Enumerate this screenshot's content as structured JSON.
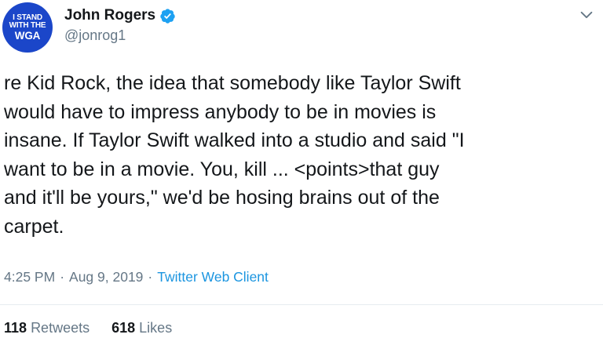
{
  "colors": {
    "avatar_bg": "#1b46c9",
    "verified_badge": "#1da1f2",
    "link": "#1b95e0",
    "secondary_text": "#657786",
    "primary_text": "#14171a"
  },
  "author": {
    "avatar_lines": [
      "I STAND",
      "WITH THE",
      "WGA"
    ],
    "display_name": "John Rogers",
    "handle": "@jonrog1",
    "verified_icon": "verified-badge-icon"
  },
  "menu": {
    "icon": "chevron-down-icon"
  },
  "tweet": {
    "lines": [
      "re Kid Rock, the idea that somebody like Taylor Swift",
      "would have to impress anybody to be in movies is",
      "insane. If Taylor Swift walked into a studio and said \"I",
      "want to be in a movie. You, kill ... <points>that guy",
      "and it'll be yours,\" we'd be hosing brains out of the",
      "carpet."
    ]
  },
  "meta": {
    "time": "4:25 PM",
    "separator": "·",
    "date": "Aug 9, 2019",
    "client": "Twitter Web Client"
  },
  "stats": {
    "retweets_count": "118",
    "retweets_label": "Retweets",
    "likes_count": "618",
    "likes_label": "Likes"
  }
}
